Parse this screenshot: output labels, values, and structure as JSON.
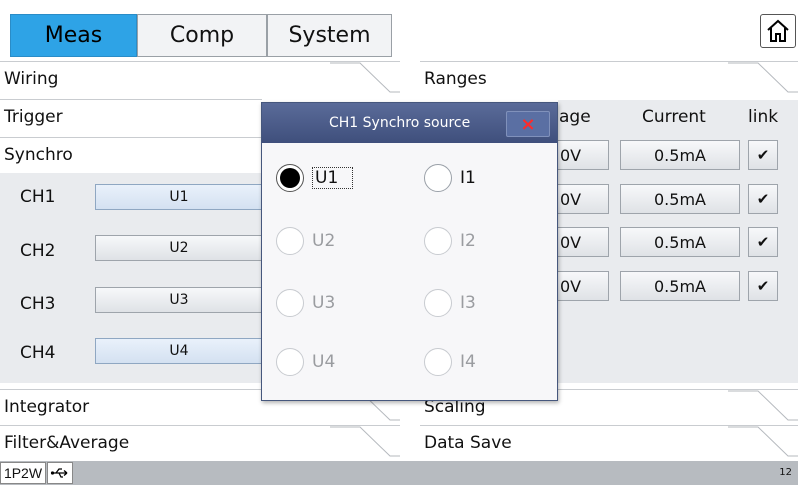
{
  "tabs": [
    {
      "label": "Meas",
      "active": true
    },
    {
      "label": "Comp",
      "active": false
    },
    {
      "label": "System",
      "active": false
    }
  ],
  "home_icon": "home-icon",
  "sections": {
    "wiring": "Wiring",
    "ranges": "Ranges",
    "trigger": "Trigger",
    "synchro": "Synchro",
    "integrator": "Integrator",
    "scaling": "Scaling",
    "filter_average": "Filter&Average",
    "data_save": "Data Save"
  },
  "synchro": {
    "channels": [
      {
        "label": "CH1",
        "source": "U1"
      },
      {
        "label": "CH2",
        "source": "U2"
      },
      {
        "label": "CH3",
        "source": "U3"
      },
      {
        "label": "CH4",
        "source": "U4"
      }
    ]
  },
  "ranges": {
    "voltage_header_partial": "age",
    "current_header": "Current",
    "link_header": "link",
    "rows": [
      {
        "voltage_partial": "0V",
        "current": "0.5mA",
        "link": "✔"
      },
      {
        "voltage_partial": "0V",
        "current": "0.5mA",
        "link": "✔"
      },
      {
        "voltage_partial": "0V",
        "current": "0.5mA",
        "link": "✔"
      },
      {
        "voltage_partial": "0V",
        "current": "0.5mA",
        "link": "✔"
      }
    ]
  },
  "dialog": {
    "title": "CH1 Synchro source",
    "close_label": "×",
    "options": {
      "u1": "U1",
      "u2": "U2",
      "u3": "U3",
      "u4": "U4",
      "i1": "I1",
      "i2": "I2",
      "i3": "I3",
      "i4": "I4"
    },
    "selected": "U1"
  },
  "status": {
    "wiring_mode": "1P2W",
    "usb_icon": "usb-icon",
    "page_number": "12"
  }
}
